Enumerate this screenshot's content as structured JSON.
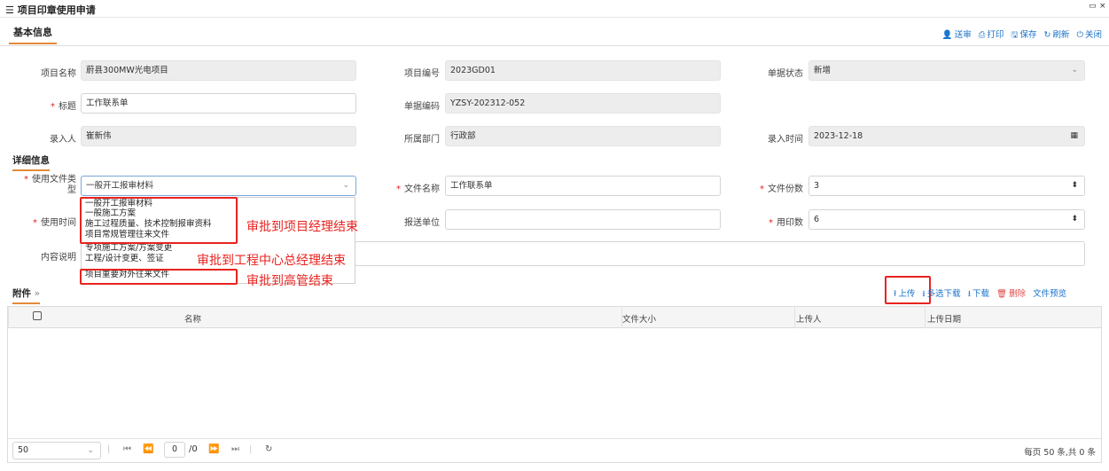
{
  "window": {
    "title": "项目印章使用申请",
    "max_glyph": "▭",
    "close_glyph": "×"
  },
  "tabs": {
    "basic": "基本信息"
  },
  "toolbar": {
    "submit": "送审",
    "print": "打印",
    "save": "保存",
    "refresh": "刷新",
    "close": "关闭"
  },
  "basic": {
    "project_name": {
      "label": "项目名称",
      "value": "蔚县300MW光电项目"
    },
    "project_no": {
      "label": "项目编号",
      "value": "2023GD01"
    },
    "doc_status": {
      "label": "单据状态",
      "value": "新增"
    },
    "title": {
      "label": "标题",
      "value": "工作联系单"
    },
    "doc_code": {
      "label": "单据编码",
      "value": "YZSY-202312-052"
    },
    "entered_by": {
      "label": "录入人",
      "value": "崔新伟"
    },
    "department": {
      "label": "所属部门",
      "value": "行政部"
    },
    "entry_time": {
      "label": "录入时间",
      "value": "2023-12-18"
    }
  },
  "detail": {
    "section": "详细信息",
    "file_type": {
      "label_line1": "使用文件类",
      "label_line2": "型",
      "value": "一般开工报审材料"
    },
    "file_name": {
      "label": "文件名称",
      "value": "工作联系单"
    },
    "file_copies": {
      "label": "文件份数",
      "value": "3"
    },
    "use_time": {
      "label": "使用时间",
      "value": ""
    },
    "submit_unit": {
      "label": "报送单位",
      "value": ""
    },
    "print_count": {
      "label": "用印数",
      "value": "6"
    },
    "content": {
      "label": "内容说明",
      "value": ""
    }
  },
  "dropdown": {
    "options": [
      "一般开工报审材料",
      "一般施工方案",
      "施工过程质量、技术控制报审资料",
      "项目常规管理往来文件",
      "专项施工方案/方案变更",
      "工程/设计变更、签证",
      "项目重要对外往来文件"
    ]
  },
  "annotations": {
    "a1": "审批到项目经理结束",
    "a2": "审批到工程中心总经理结束",
    "a3": "审批到高管结束"
  },
  "attachments": {
    "section": "附件",
    "collapse_glyph": "»",
    "actions": {
      "upload": "上传",
      "multi_download": "多选下载",
      "download": "下载",
      "delete": "删除",
      "preview": "文件预览"
    },
    "columns": {
      "name": "名称",
      "size": "文件大小",
      "uploader": "上传人",
      "upload_date": "上传日期"
    }
  },
  "pager": {
    "page_size": "50",
    "current_page": "0",
    "total_pages": "/0",
    "summary": "每页 50 条,共 0 条"
  }
}
